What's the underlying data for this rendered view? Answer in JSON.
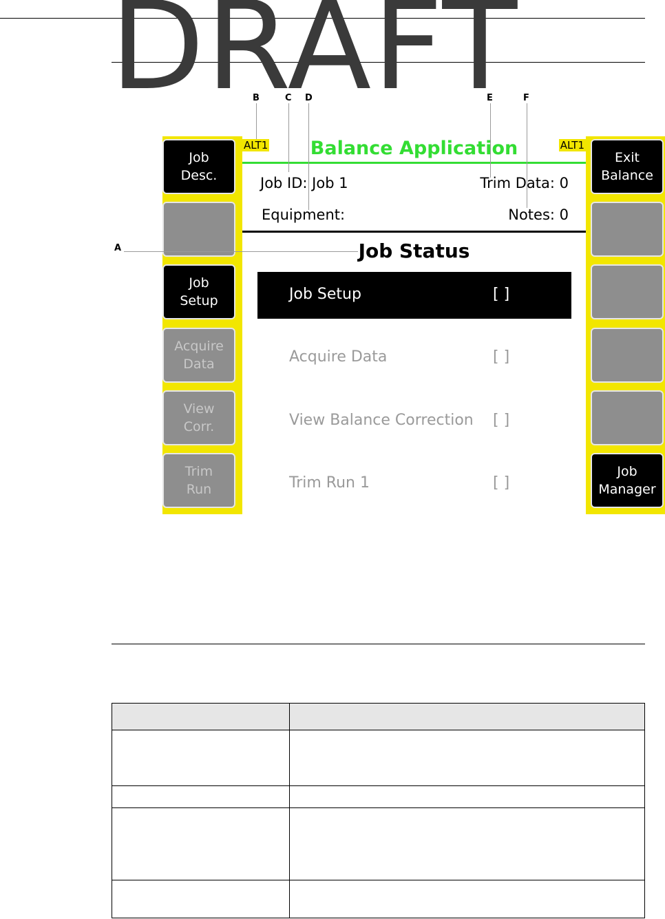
{
  "watermark": "DRAFT",
  "callouts": {
    "a": "A",
    "b": "B",
    "c": "C",
    "d": "D",
    "e": "E",
    "f": "F"
  },
  "device": {
    "alt_left": "ALT1",
    "alt_right": "ALT1",
    "title": "Balance Application",
    "job_id": "Job ID: Job 1",
    "trim_data": "Trim Data: 0",
    "equipment": "Equipment:",
    "notes": "Notes: 0",
    "status_title": "Job Status",
    "left_keys": [
      "Job\nDesc.",
      "",
      "Job\nSetup",
      "Acquire\nData",
      "View\nCorr.",
      "Trim\nRun"
    ],
    "right_keys": [
      "Exit\nBalance",
      "",
      "",
      "",
      "",
      "Job\nManager"
    ],
    "rows": [
      {
        "label": "Job Setup",
        "mark": "[   ]"
      },
      {
        "label": "Acquire Data",
        "mark": "[   ]"
      },
      {
        "label": "View Balance Correction",
        "mark": "[   ]"
      },
      {
        "label": "Trim Run 1",
        "mark": "[   ]"
      }
    ]
  }
}
